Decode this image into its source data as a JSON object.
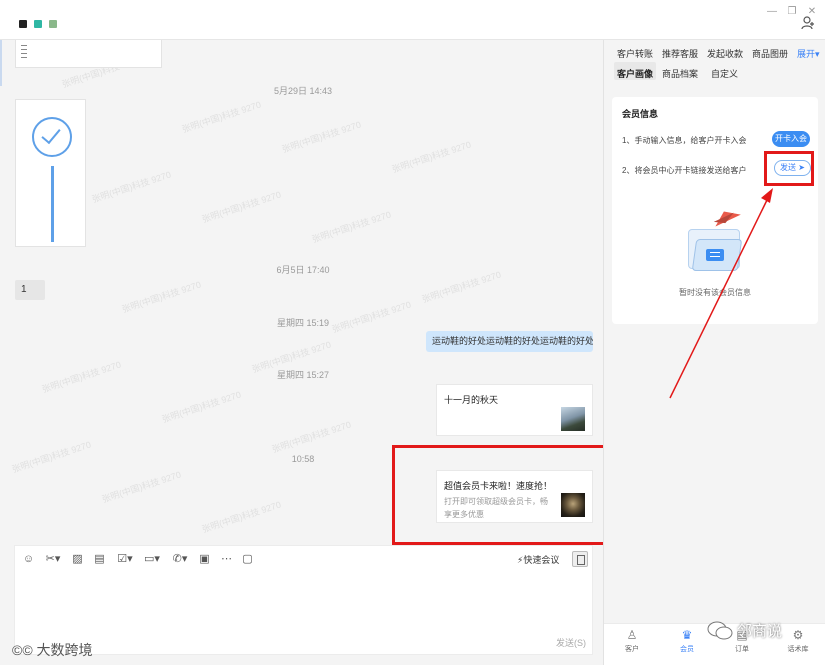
{
  "colors": {
    "accent": "#3b82f6",
    "highlight_red": "#e21919",
    "outgoing_bubble": "#cfe6fc"
  },
  "titlebar": {
    "icons": [
      "flag-icon",
      "teal-square-icon",
      "green-square-icon"
    ],
    "window_buttons": [
      "—",
      "❐",
      "✕"
    ],
    "user_icon": "add-user-icon"
  },
  "chat": {
    "watermark": "张明(中国)科技 9270",
    "timestamps": [
      "5月29日 14:43",
      "6月5日 17:40",
      "星期四 15:19",
      "星期四 15:27",
      "10:58"
    ],
    "incoming_text": "1",
    "outgoing_text": "运动鞋的好处运动鞋的好处运动鞋的好处",
    "link_card_1": {
      "title": "十一月的秋天",
      "thumb": "landscape-thumbnail"
    },
    "link_card_2": {
      "title": "超值会员卡来啦！速度抢！",
      "description": "打开即可领取超级会员卡，畅享更多优惠",
      "thumb": "member-card-thumbnail"
    }
  },
  "input": {
    "tools": [
      "emoji-icon",
      "scissors-icon",
      "image-icon",
      "file-text-icon",
      "checklist-icon",
      "folder-icon",
      "phone-icon",
      "red-packet-icon",
      "more-icon",
      "screen-icon"
    ],
    "quick_meeting": "快速会议",
    "send_label": "发送(S)"
  },
  "right_panel": {
    "tabs_row1": [
      "客户转账",
      "推荐客服",
      "发起收款",
      "商品图册"
    ],
    "expand_label": "展开",
    "tabs_row2": [
      "客户画像",
      "商品档案",
      "自定义"
    ],
    "card_title": "会员信息",
    "step1": "1、手动输入信息，给客户开卡入会",
    "open_card_button": "开卡入会",
    "step2": "2、将会员中心开卡链接发送给客户",
    "send_button": "发送",
    "empty_text": "暂时没有该会员信息",
    "nav": [
      {
        "label": "客户",
        "icon": "customer-icon"
      },
      {
        "label": "会员",
        "icon": "crown-icon"
      },
      {
        "label": "订单",
        "icon": "order-icon"
      },
      {
        "label": "话术库",
        "icon": "script-library-icon"
      }
    ]
  },
  "overlay": {
    "brand_left": "大数跨境",
    "brand_right": "邻商说"
  }
}
